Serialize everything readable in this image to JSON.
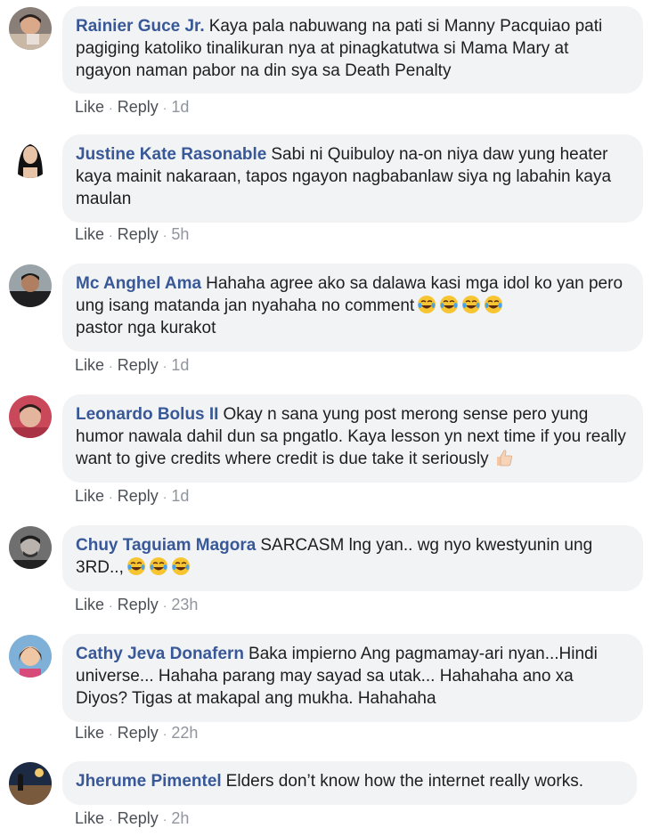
{
  "comments": [
    {
      "author": "Rainier Guce Jr.",
      "text": "Kaya pala nabuwang na pati si Manny Pacquiao pati pagiging katoliko tinalikuran nya at pinagkatutwa si Mama Mary at ngayon naman pabor na din sya sa Death Penalty",
      "like": "Like",
      "reply": "Reply",
      "time": "1d"
    },
    {
      "author": "Justine Kate Rasonable",
      "text": "Sabi ni Quibuloy na-on niya daw yung heater kaya mainit nakaraan, tapos ngayon nagbabanlaw siya ng labahin kaya maulan",
      "like": "Like",
      "reply": "Reply",
      "time": "5h"
    },
    {
      "author": "Mc Anghel Ama",
      "text": "Hahaha agree ako sa dalawa kasi mga idol ko yan pero ung isang matanda jan nyahaha no comment",
      "text_after": "pastor nga kurakot",
      "emoji": "laughing-crying-emoji",
      "emoji_count": 4,
      "like": "Like",
      "reply": "Reply",
      "time": "1d"
    },
    {
      "author": "Leonardo Bolus II",
      "text": "Okay n sana yung post merong sense pero yung humor nawala dahil dun sa pngatlo. Kaya lesson yn next time if you really want to give credits where credit is due take it seriously",
      "emoji": "thumbs-up-emoji",
      "like": "Like",
      "reply": "Reply",
      "time": "1d"
    },
    {
      "author": "Chuy Taguiam Magora",
      "text": "SARCASM lng yan.. wg nyo kwestyunin ung 3RD..,",
      "emoji": "laughing-crying-emoji",
      "emoji_count": 3,
      "like": "Like",
      "reply": "Reply",
      "time": "23h"
    },
    {
      "author": "Cathy Jeva Donafern",
      "text": "Baka impierno Ang pagmamay-ari nyan...Hindi universe... Hahaha parang may sayad sa utak... Hahahaha ano xa Diyos? Tigas at makapal ang mukha. Hahahaha",
      "like": "Like",
      "reply": "Reply",
      "time": "22h"
    },
    {
      "author": "Jherume Pimentel",
      "text": "Elders don’t know how the internet really works.",
      "like": "Like",
      "reply": "Reply",
      "time": "2h"
    }
  ],
  "colors": {
    "author": "#385898",
    "bubble": "#f2f3f5",
    "text": "#1c1e21",
    "meta": "#90949c"
  }
}
